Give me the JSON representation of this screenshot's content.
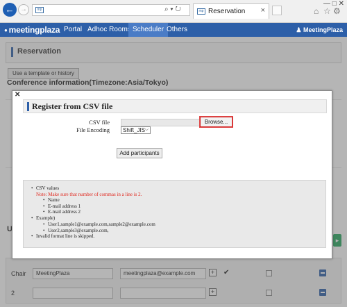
{
  "browser": {
    "tab_title": "Reservation",
    "tab_close": "×",
    "address_text": "",
    "address_controls": "⌕ ▾ ↻",
    "favicon_text": "mp",
    "win_controls": "—  □  ✕"
  },
  "navbar": {
    "logo": "meetingplaza",
    "logo_prefix": "●",
    "items": [
      "Portal",
      "Adhoc Rooms",
      "Scheduler",
      "Others"
    ],
    "active": "Scheduler",
    "user": "♟ MeetingPlaza"
  },
  "page": {
    "title": "Reservation",
    "template_button": "Use a template or history",
    "conference_heading": "Conference information(Timezone:Asia/Tokyo)",
    "section_letter": "U"
  },
  "participants": [
    {
      "label": "Chair",
      "name": "MeetingPlaza",
      "email": "meetingplaza@example.com",
      "checked": true
    },
    {
      "label": "2",
      "name": "",
      "email": "",
      "checked": false
    }
  ],
  "modal": {
    "close": "✕",
    "title": "Register from CSV file",
    "csv_label": "CSV file",
    "encoding_label": "File Encoding",
    "browse_button": "Browse...",
    "encoding_value": "Shift_JIS",
    "add_button": "Add participants",
    "help": {
      "csv_values": "CSV values",
      "note": "Note: Make sure that number of commas in a line is 2.",
      "fields": [
        "Name",
        "E-mail address 1",
        "E-mail address 2"
      ],
      "example_label": "Example)",
      "examples": [
        "User1,sample1@example.com,sample2@example.com",
        "User2,sample3@example.com,"
      ],
      "invalid": "Invalid format line is skipped."
    }
  }
}
